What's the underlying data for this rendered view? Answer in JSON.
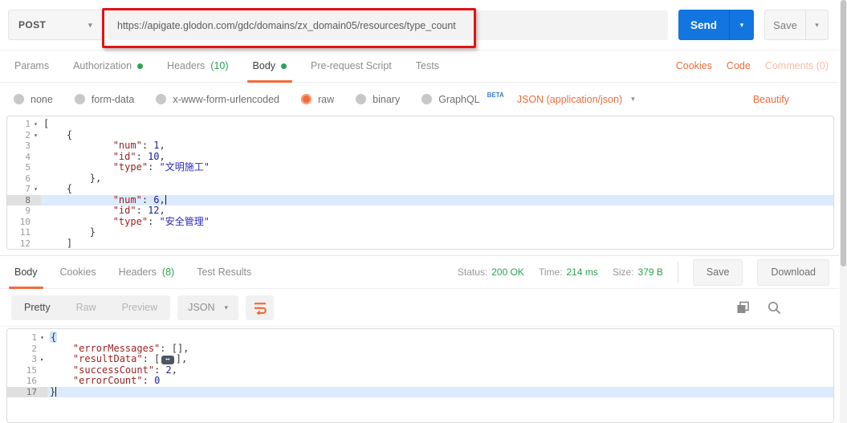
{
  "colors": {
    "accent_orange": "#f26b3b",
    "success_green": "#2aa44e",
    "send_blue": "#1275e0",
    "annotation_red": "#e01414",
    "key_color": "#9c1f1f",
    "number_color": "#1a1aa6",
    "string_color": "#2b2bc0",
    "line_highlight": "#dbeafc",
    "badge_bg": "#4a5661"
  },
  "request_bar": {
    "method": "POST",
    "url": "https://apigate.glodon.com/gdc/domains/zx_domain05/resources/type_count",
    "send_label": "Send",
    "save_label": "Save"
  },
  "request_tabs": {
    "items": [
      {
        "label": "Params"
      },
      {
        "label": "Authorization",
        "dot": true
      },
      {
        "label": "Headers",
        "count": "(10)"
      },
      {
        "label": "Body",
        "dot": true,
        "active": true
      },
      {
        "label": "Pre-request Script"
      },
      {
        "label": "Tests"
      }
    ],
    "links": [
      {
        "label": "Cookies"
      },
      {
        "label": "Code"
      },
      {
        "label": "Comments (0)",
        "muted": true
      }
    ]
  },
  "body_type_bar": {
    "options": [
      {
        "label": "none"
      },
      {
        "label": "form-data"
      },
      {
        "label": "x-www-form-urlencoded"
      },
      {
        "label": "raw",
        "selected": true
      },
      {
        "label": "binary"
      },
      {
        "label": "GraphQL",
        "badge": "BETA"
      }
    ],
    "content_type": "JSON (application/json)",
    "beautify_label": "Beautify"
  },
  "request_editor": {
    "lines": [
      {
        "n": "1",
        "f": "d",
        "t": [
          {
            "c": "p",
            "v": "["
          }
        ]
      },
      {
        "n": "2",
        "f": "d",
        "t": [
          {
            "c": "p",
            "v": "    {"
          }
        ]
      },
      {
        "n": "3",
        "t": [
          {
            "c": "p",
            "v": "            "
          },
          {
            "c": "k",
            "v": "\"num\""
          },
          {
            "c": "p",
            "v": ": "
          },
          {
            "c": "n",
            "v": "1"
          },
          {
            "c": "p",
            "v": ","
          }
        ]
      },
      {
        "n": "4",
        "t": [
          {
            "c": "p",
            "v": "            "
          },
          {
            "c": "k",
            "v": "\"id\""
          },
          {
            "c": "p",
            "v": ": "
          },
          {
            "c": "n",
            "v": "10"
          },
          {
            "c": "p",
            "v": ","
          }
        ]
      },
      {
        "n": "5",
        "t": [
          {
            "c": "p",
            "v": "            "
          },
          {
            "c": "k",
            "v": "\"type\""
          },
          {
            "c": "p",
            "v": ": "
          },
          {
            "c": "s",
            "v": "\"文明施工\""
          }
        ]
      },
      {
        "n": "6",
        "t": [
          {
            "c": "p",
            "v": "        },"
          }
        ]
      },
      {
        "n": "7",
        "f": "d",
        "t": [
          {
            "c": "p",
            "v": "    {"
          }
        ]
      },
      {
        "n": "8",
        "a": true,
        "t": [
          {
            "c": "p",
            "v": "            "
          },
          {
            "c": "k",
            "v": "\"num\""
          },
          {
            "c": "p",
            "v": ": "
          },
          {
            "c": "n",
            "v": "6"
          },
          {
            "c": "p",
            "v": ","
          },
          {
            "c": "cur",
            "v": ""
          }
        ]
      },
      {
        "n": "9",
        "t": [
          {
            "c": "p",
            "v": "            "
          },
          {
            "c": "k",
            "v": "\"id\""
          },
          {
            "c": "p",
            "v": ": "
          },
          {
            "c": "n",
            "v": "12"
          },
          {
            "c": "p",
            "v": ","
          }
        ]
      },
      {
        "n": "10",
        "t": [
          {
            "c": "p",
            "v": "            "
          },
          {
            "c": "k",
            "v": "\"type\""
          },
          {
            "c": "p",
            "v": ": "
          },
          {
            "c": "s",
            "v": "\"安全管理\""
          }
        ]
      },
      {
        "n": "11",
        "t": [
          {
            "c": "p",
            "v": "        }"
          }
        ]
      },
      {
        "n": "12",
        "t": [
          {
            "c": "p",
            "v": "    ]"
          }
        ]
      }
    ]
  },
  "response_section": {
    "tabs": [
      {
        "label": "Body",
        "active": true
      },
      {
        "label": "Cookies"
      },
      {
        "label": "Headers",
        "count": "(8)"
      },
      {
        "label": "Test Results"
      }
    ],
    "status_label": "Status:",
    "status_value": "200 OK",
    "time_label": "Time:",
    "time_value": "214 ms",
    "size_label": "Size:",
    "size_value": "379 B",
    "save_label": "Save",
    "download_label": "Download",
    "views": [
      {
        "label": "Pretty",
        "active": true
      },
      {
        "label": "Raw"
      },
      {
        "label": "Preview"
      }
    ],
    "format_label": "JSON"
  },
  "response_editor": {
    "lines": [
      {
        "n": "1",
        "f": "d",
        "t": [
          {
            "c": "brk",
            "v": "{"
          }
        ]
      },
      {
        "n": "2",
        "t": [
          {
            "c": "p",
            "v": "    "
          },
          {
            "c": "k",
            "v": "\"errorMessages\""
          },
          {
            "c": "p",
            "v": ": [],"
          }
        ]
      },
      {
        "n": "3",
        "f": "r",
        "t": [
          {
            "c": "p",
            "v": "    "
          },
          {
            "c": "k",
            "v": "\"resultData\""
          },
          {
            "c": "p",
            "v": ": ["
          },
          {
            "c": "badge",
            "v": "↔"
          },
          {
            "c": "p",
            "v": "],"
          }
        ]
      },
      {
        "n": "15",
        "t": [
          {
            "c": "p",
            "v": "    "
          },
          {
            "c": "k",
            "v": "\"successCount\""
          },
          {
            "c": "p",
            "v": ": "
          },
          {
            "c": "n",
            "v": "2"
          },
          {
            "c": "p",
            "v": ","
          }
        ]
      },
      {
        "n": "16",
        "t": [
          {
            "c": "p",
            "v": "    "
          },
          {
            "c": "k",
            "v": "\"errorCount\""
          },
          {
            "c": "p",
            "v": ": "
          },
          {
            "c": "n",
            "v": "0"
          }
        ]
      },
      {
        "n": "17",
        "a": true,
        "t": [
          {
            "c": "p",
            "v": "}"
          },
          {
            "c": "cur",
            "v": ""
          }
        ]
      }
    ]
  }
}
